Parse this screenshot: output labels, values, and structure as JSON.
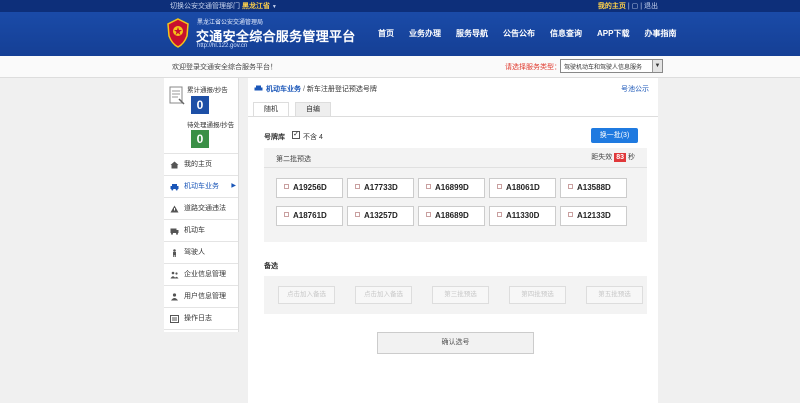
{
  "topbar": {
    "switch_prefix": "切换公安交通管理部门 ",
    "province": "黑龙江省",
    "caret": "▼",
    "my_home": "我的主页",
    "sep1": "|",
    "icon_box": "▢",
    "sep2": "|",
    "logout": "退出"
  },
  "header": {
    "subtitle": "黑龙江省公安交通管理局",
    "title": "交通安全综合服务管理平台",
    "url": "http://hl.122.gov.cn",
    "nav": [
      "首页",
      "业务办理",
      "服务导航",
      "公告公布",
      "信息查询",
      "APP下载",
      "办事指南"
    ]
  },
  "welcome": {
    "message": "欢迎登录交通安全综合服务平台！",
    "service_label": "请选择服务类型：",
    "service_value": "驾驶机动车和驾驶人信息服务"
  },
  "sidebar": {
    "stat1_label": "累计通报/抄告",
    "stat1_value": "0",
    "stat2_label": "待处理通报/抄告",
    "stat2_value": "0",
    "items": [
      {
        "label": "我的主页",
        "icon": "home-icon"
      },
      {
        "label": "机动车业务",
        "icon": "car-icon",
        "active": true,
        "caret": "▶"
      },
      {
        "label": "道路交通违法",
        "icon": "warning-icon"
      },
      {
        "label": "机动车",
        "icon": "vehicle-icon"
      },
      {
        "label": "驾驶人",
        "icon": "driver-icon"
      },
      {
        "label": "企业信息管理",
        "icon": "company-icon"
      },
      {
        "label": "用户信息管理",
        "icon": "user-icon"
      },
      {
        "label": "操作日志",
        "icon": "log-icon"
      }
    ]
  },
  "main": {
    "crumb1": "机动车业务",
    "crumb_sep": " / ",
    "crumb2": "新车注册登记预选号牌",
    "notice": "号池公示",
    "tabs": [
      "随机",
      "自编"
    ],
    "library_label": "号牌库",
    "exclude_checkbox": "✓",
    "exclude_label": "不含 4",
    "swap_button": "换一批(3)",
    "batch_name": "第二批预选",
    "countdown_prefix": "距失效",
    "countdown_value": "83",
    "countdown_unit": "秒",
    "plates": [
      "A19256D",
      "A17733D",
      "A16899D",
      "A18061D",
      "A13588D",
      "A18761D",
      "A13257D",
      "A18689D",
      "A11330D",
      "A12133D"
    ],
    "reserve_label": "备选",
    "slots": [
      "点击加入备选",
      "点击加入备选",
      "第三批预选",
      "第四批预选",
      "第五批预选"
    ],
    "confirm_button": "确认选号"
  }
}
